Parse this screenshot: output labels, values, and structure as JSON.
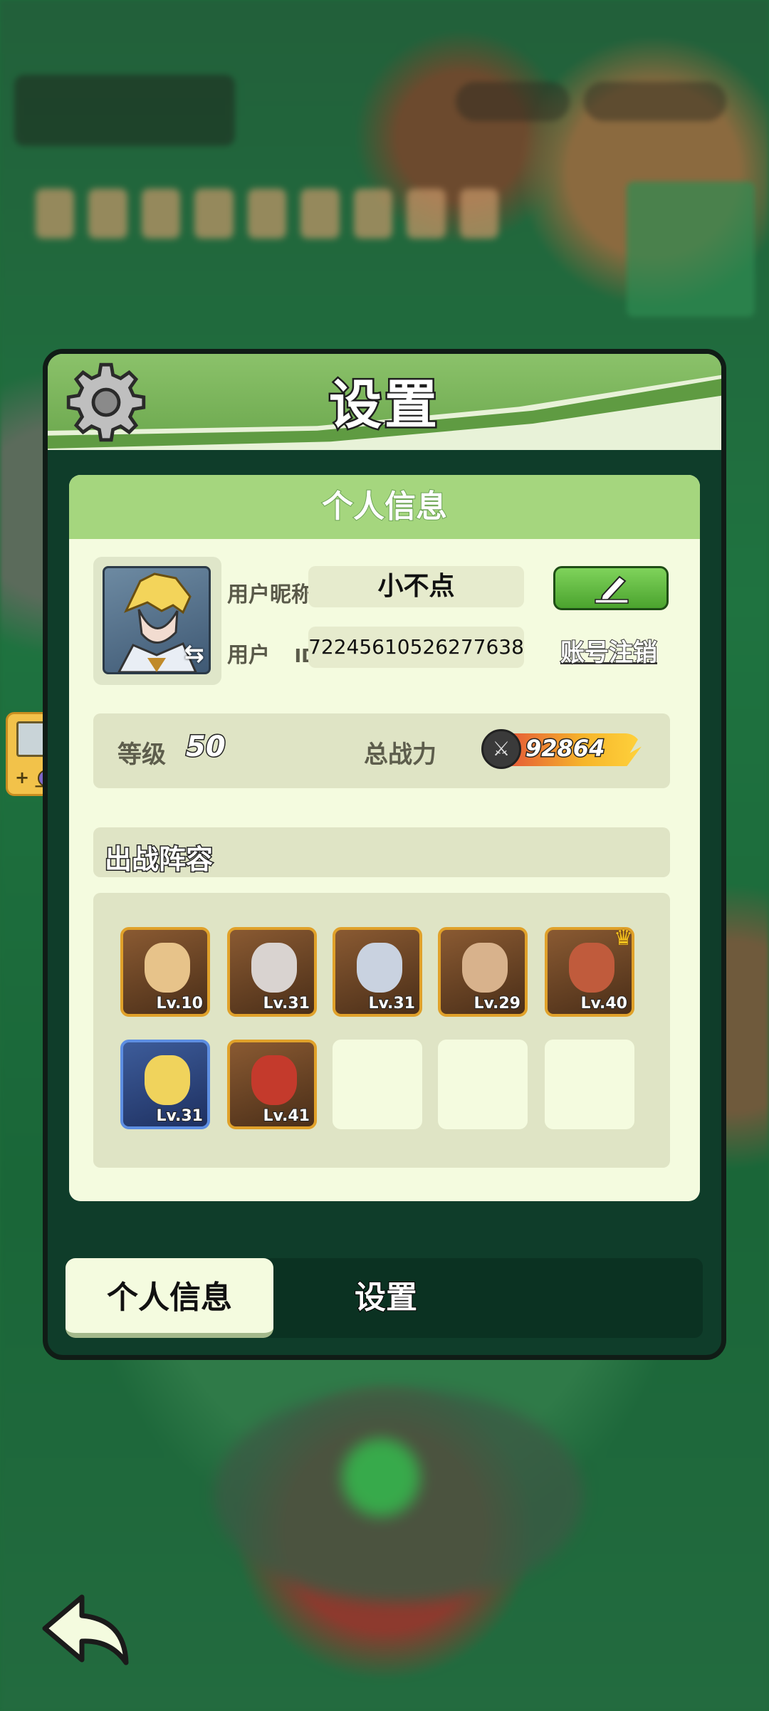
{
  "panel": {
    "title": "设置",
    "card_title": "个人信息"
  },
  "profile": {
    "nickname_label": "用户昵称",
    "nickname": "小不点",
    "id_label": "用户",
    "id_suffix": "ID",
    "user_id": "72245610526277638",
    "logout_label": "账号注销"
  },
  "stats": {
    "level_label": "等级",
    "level": "50",
    "power_label": "总战力",
    "power": "92864"
  },
  "lineup": {
    "title": "出战阵容",
    "heroes": [
      {
        "level": "Lv.10",
        "color": "#e7c38a"
      },
      {
        "level": "Lv.31",
        "color": "#d9d3d0"
      },
      {
        "level": "Lv.31",
        "color": "#c9d2e0"
      },
      {
        "level": "Lv.29",
        "color": "#d8b28c"
      },
      {
        "level": "Lv.40",
        "color": "#c05b3c"
      },
      {
        "level": "Lv.31",
        "color": "#f0d35c"
      },
      {
        "level": "Lv.41",
        "color": "#c43a2c"
      }
    ],
    "empty_slots": 3
  },
  "tabs": {
    "active": "个人信息",
    "inactive": "设置"
  },
  "colors": {
    "accent_green": "#5f9b42",
    "card_bg": "#f4fbdf",
    "hero_border": "#e0a12a"
  },
  "icons": [
    "gear-icon",
    "edit-pencil-icon",
    "swap-icon",
    "sword-icon",
    "crown-icon",
    "back-arrow-icon",
    "gameboy-icon"
  ]
}
